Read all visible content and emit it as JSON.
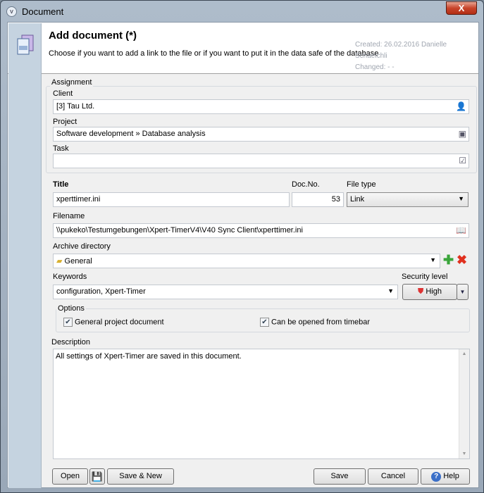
{
  "window": {
    "title": "Document",
    "close_label": "X"
  },
  "header": {
    "title": "Add document (*)",
    "subtitle": "Choose if you want to add a link to the file or if you want to put it in the data safe of the database",
    "created": "Created: 26.02.2016  Danielle Schaelchli",
    "changed": "Changed: -                 -"
  },
  "assignment": {
    "label": "Assignment",
    "client_label": "Client",
    "client_value": "[3] Tau Ltd.",
    "project_label": "Project",
    "project_value": "Software development » Database analysis",
    "task_label": "Task",
    "task_value": ""
  },
  "title_label": "Title",
  "title_value": "xperttimer.ini",
  "docno_label": "Doc.No.",
  "docno_value": "53",
  "filetype_label": "File type",
  "filetype_value": "Link",
  "filename_label": "Filename",
  "filename_value": "\\\\pukeko\\Testumgebungen\\Xpert-TimerV4\\V40 Sync Client\\xperttimer.ini",
  "archive_label": "Archive directory",
  "archive_value": "General",
  "keywords_label": "Keywords",
  "keywords_value": "configuration, Xpert-Timer",
  "security_label": "Security level",
  "security_value": "High",
  "options": {
    "label": "Options",
    "general_project": "General project document",
    "general_checked": true,
    "timebar": "Can be opened from timebar",
    "timebar_checked": true
  },
  "description_label": "Description",
  "description_value": "All settings of Xpert-Timer are saved in this document.",
  "buttons": {
    "open": "Open",
    "save_new": "Save & New",
    "save": "Save",
    "cancel": "Cancel",
    "help": "Help"
  },
  "colors": {
    "accent_add": "#3aa53a",
    "accent_delete": "#e0301e"
  }
}
